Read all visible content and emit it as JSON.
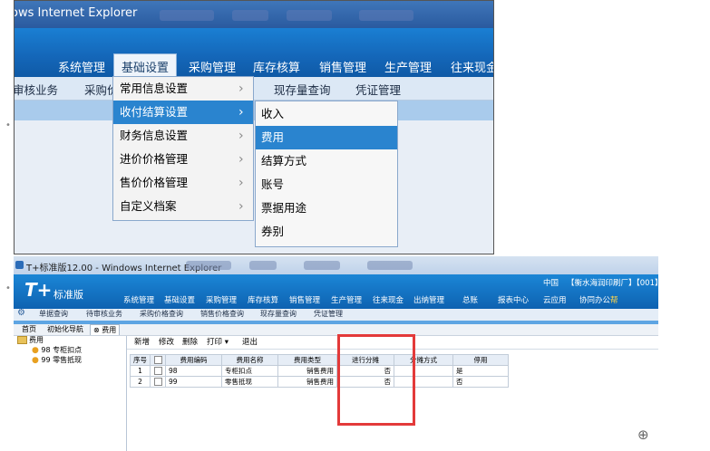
{
  "top": {
    "window_title": "ows Internet Explorer",
    "nav": [
      "系统管理",
      "基础设置",
      "采购管理",
      "库存核算",
      "销售管理",
      "生产管理",
      "往来现金"
    ],
    "subnav": [
      "审核业务",
      "采购价",
      "现存量查询",
      "凭证管理"
    ],
    "menu1": [
      {
        "label": "常用信息设置",
        "arrow": "›"
      },
      {
        "label": "收付结算设置",
        "arrow": "›"
      },
      {
        "label": "财务信息设置",
        "arrow": "›"
      },
      {
        "label": "进价价格管理",
        "arrow": "›"
      },
      {
        "label": "售价价格管理",
        "arrow": "›"
      },
      {
        "label": "自定义档案",
        "arrow": "›"
      }
    ],
    "menu2": [
      "收入",
      "费用",
      "结算方式",
      "账号",
      "票据用途",
      "券别"
    ]
  },
  "bottom": {
    "window_title": "T+标准版12.00 - Windows Internet Explorer",
    "logo": "T+",
    "edition": "标准版",
    "top_right": [
      "中国",
      "【衡水海润印刷厂】【001】"
    ],
    "nav": [
      "系统管理",
      "基础设置",
      "采购管理",
      "库存核算",
      "销售管理",
      "生产管理",
      "往来现金",
      "出纳管理",
      "总账",
      "报表中心",
      "云应用",
      "协同办公"
    ],
    "nav_mark": "帮",
    "subnav": [
      "单据查询",
      "待审核业务",
      "采购价格查询",
      "销售价格查询",
      "现存量查询",
      "凭证管理"
    ],
    "tabs": [
      "首页",
      "初始化导航",
      "费用"
    ],
    "tab_close": "⊗",
    "tree": {
      "root": "费用",
      "children": [
        "98 专柜扣点",
        "99 零售抵现"
      ]
    },
    "toolbar": [
      "新增",
      "修改",
      "删除",
      "打印 ▾",
      "退出"
    ],
    "table": {
      "headers": [
        "序号",
        "",
        "费用编码",
        "费用名称",
        "费用类型",
        "进行分摊",
        "分摊方式",
        "停用"
      ],
      "rows": [
        [
          "1",
          "",
          "98",
          "专柜扣点",
          "销售费用",
          "否",
          "",
          "是"
        ],
        [
          "2",
          "",
          "99",
          "零售抵现",
          "销售费用",
          "否",
          "",
          "否"
        ]
      ]
    }
  },
  "colors": {
    "accent": "#2a84cf",
    "highlight_box": "#e33a3a",
    "nav_band": "#1466b8"
  },
  "icons": {
    "gear": "gear-icon",
    "zoom": "zoom-in-icon",
    "folder": "folder-icon"
  }
}
